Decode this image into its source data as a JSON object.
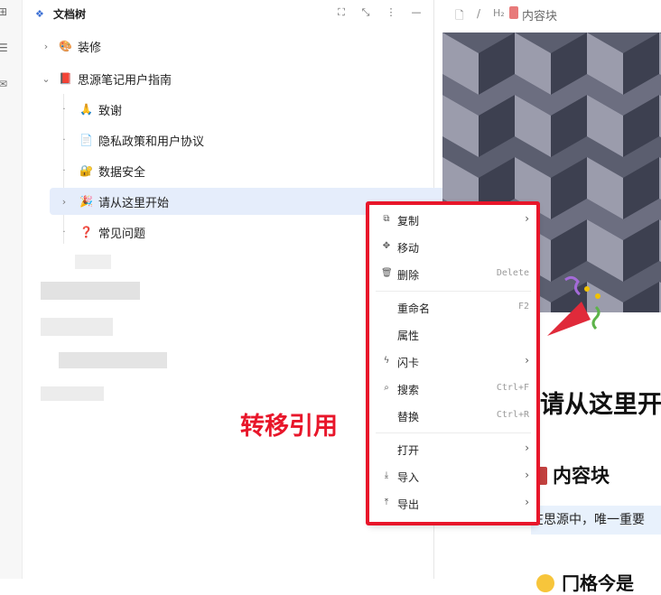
{
  "tree": {
    "title": "文档树",
    "items": [
      {
        "label": "装修",
        "icon": "🎨"
      },
      {
        "label": "思源笔记用户指南",
        "icon": "📕"
      },
      {
        "label": "致谢",
        "icon": "🙏"
      },
      {
        "label": "隐私政策和用户协议",
        "icon": "📄"
      },
      {
        "label": "数据安全",
        "icon": "🔐"
      },
      {
        "label": "请从这里开始",
        "icon": "🎉"
      },
      {
        "label": "常见问题",
        "icon": "❓"
      }
    ]
  },
  "editor": {
    "breadcrumb": {
      "sep": "/",
      "heading_tag": "H₂",
      "current": "内容块"
    },
    "heading1": "请从这里开",
    "heading2": "内容块",
    "paragraph": "在思源中，唯一重要",
    "heading2b": "冂格今是"
  },
  "context_menu": {
    "items": [
      {
        "label": "复制",
        "shortcut": "",
        "submenu": true,
        "icon": "copy-icon"
      },
      {
        "label": "移动",
        "shortcut": "",
        "submenu": false,
        "icon": "move-icon"
      },
      {
        "label": "删除",
        "shortcut": "Delete",
        "submenu": false,
        "icon": "trash-icon"
      },
      {
        "label": "重命名",
        "shortcut": "F2",
        "submenu": false,
        "icon": ""
      },
      {
        "label": "属性",
        "shortcut": "",
        "submenu": false,
        "icon": ""
      },
      {
        "label": "闪卡",
        "shortcut": "",
        "submenu": true,
        "icon": "flash-icon"
      },
      {
        "label": "搜索",
        "shortcut": "Ctrl+F",
        "submenu": false,
        "icon": "search-icon"
      },
      {
        "label": "替换",
        "shortcut": "Ctrl+R",
        "submenu": false,
        "icon": ""
      },
      {
        "label": "打开",
        "shortcut": "",
        "submenu": true,
        "icon": ""
      },
      {
        "label": "导入",
        "shortcut": "",
        "submenu": true,
        "icon": "import-icon"
      },
      {
        "label": "导出",
        "shortcut": "",
        "submenu": true,
        "icon": "export-icon"
      }
    ]
  },
  "annotation": "转移引用",
  "colors": {
    "accent": "#3b6fd4",
    "highlight": "#e8162a",
    "active_row": "#e5edfb"
  }
}
